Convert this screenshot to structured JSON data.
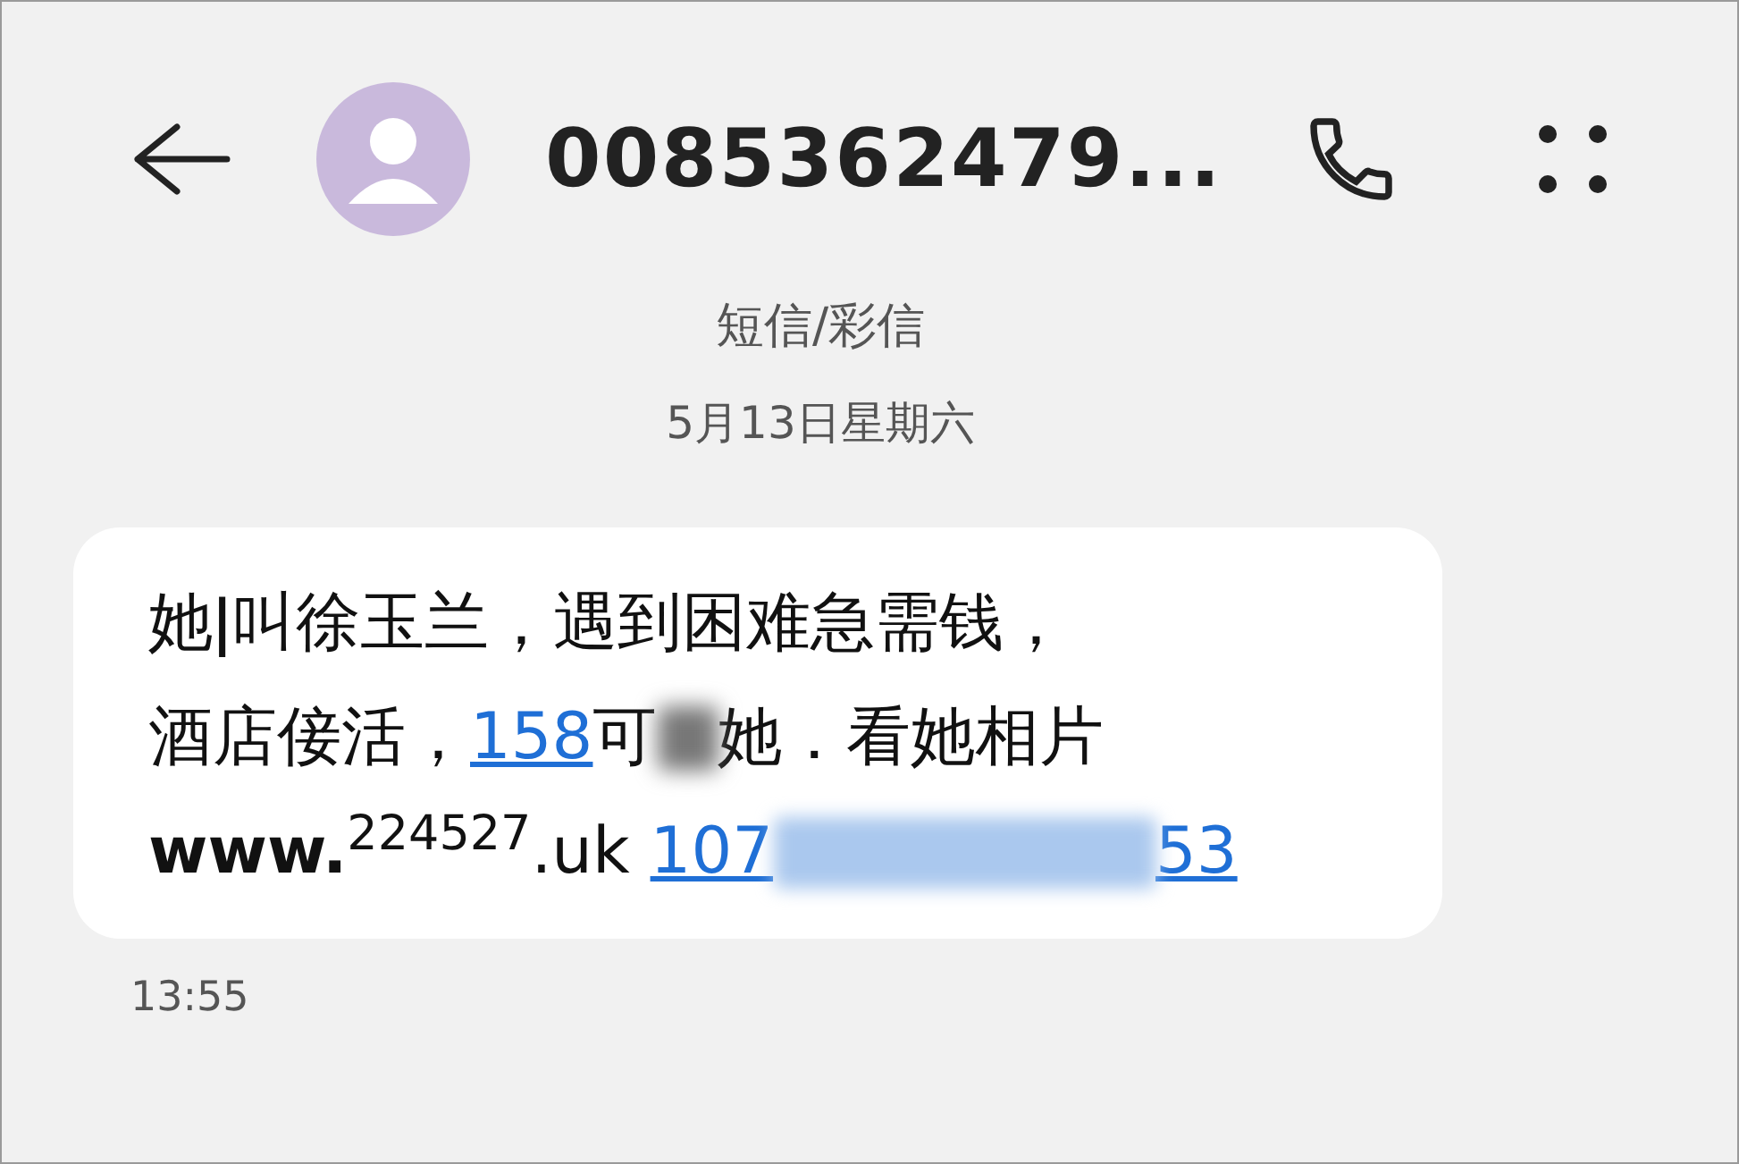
{
  "header": {
    "contact": "0085362479..."
  },
  "thread": {
    "channel": "短信/彩信",
    "date": "5月13日星期六"
  },
  "message": {
    "lines": [
      [
        {
          "kind": "text",
          "text": "她ǀ叫徐玉兰，遇到困难急需钱，"
        }
      ],
      [
        {
          "kind": "text",
          "text": "酒店倿活，"
        },
        {
          "kind": "link",
          "parts": [
            {
              "kind": "text",
              "text": "158"
            }
          ]
        },
        {
          "kind": "text",
          "text": "可"
        },
        {
          "kind": "blur"
        },
        {
          "kind": "text",
          "text": "她．看她相片"
        }
      ],
      [
        {
          "kind": "text",
          "text": "**www.**$^{224527}$.uk "
        },
        {
          "kind": "link",
          "parts": [
            {
              "kind": "text",
              "text": "107"
            },
            {
              "kind": "blur"
            },
            {
              "kind": "text",
              "text": "53"
            }
          ]
        }
      ]
    ],
    "time": "13:55"
  }
}
